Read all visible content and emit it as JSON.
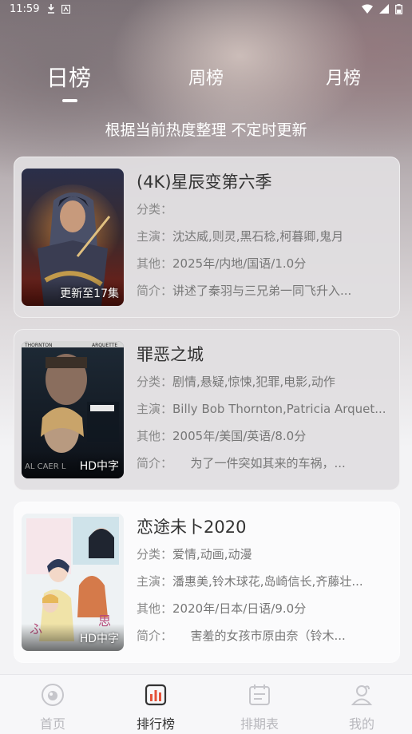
{
  "status_bar": {
    "time": "11:59"
  },
  "tabs": [
    {
      "label": "日榜",
      "active": true
    },
    {
      "label": "周榜",
      "active": false
    },
    {
      "label": "月榜",
      "active": false
    }
  ],
  "subtitle": "根据当前热度整理 不定时更新",
  "labels": {
    "category": "分类：",
    "cast": "主演：",
    "other": "其他：",
    "intro": "简介："
  },
  "items": [
    {
      "title": "(4K)星辰变第六季",
      "category": "",
      "cast": "沈达威,则灵,黑石稔,柯暮卿,鬼月",
      "other": "2025年/内地/国语/1.0分",
      "intro": "讲述了秦羽与三兄弟一同飞升入...",
      "badge": "更新至17集",
      "poster_icon": "fantasy-warrior-poster"
    },
    {
      "title": "罪恶之城",
      "category": "剧情,悬疑,惊悚,犯罪,电影,动作",
      "cast": "Billy Bob Thornton,Patricia Arquet...",
      "other": "2005年/美国/英语/8.0分",
      "intro": "　　为了一件突如其来的车祸，...",
      "badge": "HD中字",
      "poster_icon": "thriller-faces-poster"
    },
    {
      "title": "恋途未卜2020",
      "category": "爱情,动画,动漫",
      "cast": "潘惠美,铃木球花,岛崎信长,齐藤壮...",
      "other": "2020年/日本/日语/9.0分",
      "intro": "　　害羞的女孩市原由奈（铃木...",
      "badge": "HD中字",
      "poster_icon": "anime-students-poster"
    }
  ],
  "bottom_nav": [
    {
      "label": "首页",
      "icon": "home-icon",
      "active": false
    },
    {
      "label": "排行榜",
      "icon": "ranking-icon",
      "active": true
    },
    {
      "label": "排期表",
      "icon": "schedule-icon",
      "active": false
    },
    {
      "label": "我的",
      "icon": "profile-icon",
      "active": false
    }
  ]
}
